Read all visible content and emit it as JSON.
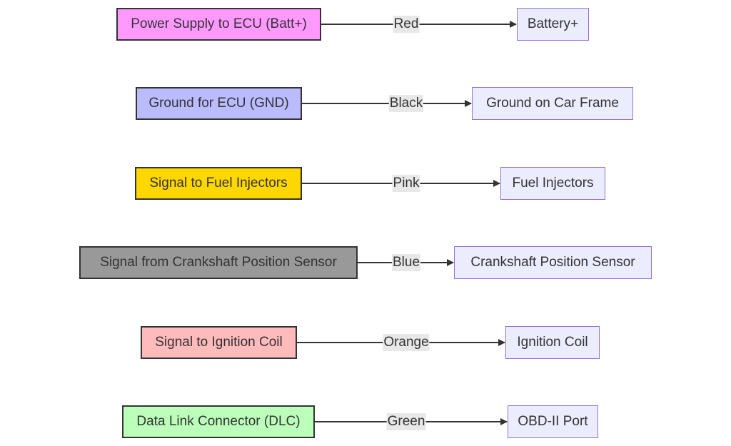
{
  "connections": [
    {
      "source": "Power Supply to ECU (Batt+)",
      "source_color": "#ff99ff",
      "wire": "Red",
      "target": "Battery+"
    },
    {
      "source": "Ground for ECU (GND)",
      "source_color": "#bbbbff",
      "wire": "Black",
      "target": "Ground on Car Frame"
    },
    {
      "source": "Signal to Fuel Injectors",
      "source_color": "#ffd700",
      "wire": "Pink",
      "target": "Fuel Injectors"
    },
    {
      "source": "Signal from Crankshaft Position Sensor",
      "source_color": "#999999",
      "wire": "Blue",
      "target": "Crankshaft Position Sensor"
    },
    {
      "source": "Signal to Ignition Coil",
      "source_color": "#ffbbbb",
      "wire": "Orange",
      "target": "Ignition Coil"
    },
    {
      "source": "Data Link Connector (DLC)",
      "source_color": "#bbffbb",
      "wire": "Green",
      "target": "OBD-II Port"
    }
  ]
}
